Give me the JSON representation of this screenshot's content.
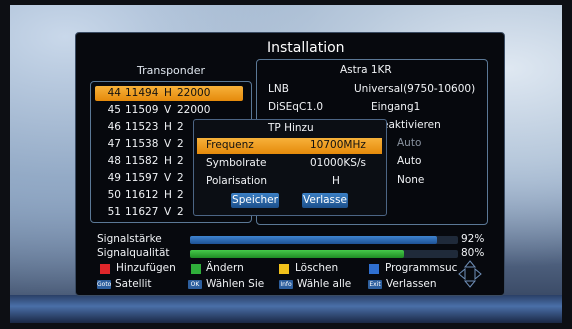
{
  "title": "Installation",
  "transponder": {
    "header": "Transponder",
    "rows": [
      {
        "num": "44",
        "freq": "11494",
        "pol": "H",
        "sr": "22000",
        "selected": true
      },
      {
        "num": "45",
        "freq": "11509",
        "pol": "V",
        "sr": "22000"
      },
      {
        "num": "46",
        "freq": "11523",
        "pol": "H",
        "sr": "2"
      },
      {
        "num": "47",
        "freq": "11538",
        "pol": "V",
        "sr": "2"
      },
      {
        "num": "48",
        "freq": "11582",
        "pol": "H",
        "sr": "2"
      },
      {
        "num": "49",
        "freq": "11597",
        "pol": "V",
        "sr": "2"
      },
      {
        "num": "50",
        "freq": "11612",
        "pol": "H",
        "sr": "2"
      },
      {
        "num": "51",
        "freq": "11627",
        "pol": "V",
        "sr": "2"
      }
    ]
  },
  "info": {
    "satellite": "Astra 1KR",
    "lnb_label": "LNB",
    "lnb_value": "Universal(9750-10600)",
    "diseqc_label": "DiSEqC1.0",
    "diseqc_value": "Eingang1",
    "row3_value": "eaktivieren",
    "row4_value": "Auto",
    "row5_value": "Auto",
    "row6_value": "None"
  },
  "popup": {
    "title": "TP Hinzu",
    "frequenz_label": "Frequenz",
    "frequenz_value": "10700MHz",
    "symbolrate_label": "Symbolrate",
    "symbolrate_value": "01000KS/s",
    "polarisation_label": "Polarisation",
    "polarisation_value": "H",
    "save_label": "Speicher",
    "exit_label": "Verlasse"
  },
  "signal": {
    "strength_label": "Signalstärke",
    "strength_pct": "92%",
    "strength_value": 0.92,
    "quality_label": "Signalqualität",
    "quality_pct": "80%",
    "quality_value": 0.8
  },
  "legend": {
    "red": "Hinzufügen",
    "green": "Ändern",
    "yellow": "Löschen",
    "blue": "Programmsuc",
    "goto_key": "Goto",
    "goto": "Satellit",
    "ok_key": "OK",
    "ok": "Wählen Sie",
    "info_key": "Info",
    "info": "Wähle alle",
    "exit_key": "Exit",
    "exit": "Verlassen"
  },
  "colors": {
    "red": "#e0262a",
    "green": "#2fae3a",
    "yellow": "#f2c21b",
    "blue": "#2f6fd0",
    "highlight": "#f3a32a"
  }
}
